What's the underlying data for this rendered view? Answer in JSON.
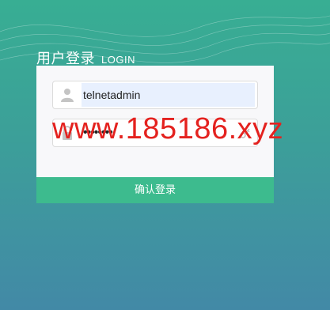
{
  "header": {
    "title_cn": "用户登录",
    "title_en": "LOGIN"
  },
  "form": {
    "username": {
      "value": "telnetadmin",
      "icon": "user-icon"
    },
    "password": {
      "value": "••••••••",
      "icon": "lock-icon",
      "reveal_icon": "key-icon"
    },
    "submit_label": "确认登录"
  },
  "watermark": "www.185186.xyz",
  "colors": {
    "accent": "#3dbb8e",
    "watermark": "#e4221f",
    "autofill": "#e8f0fe"
  }
}
